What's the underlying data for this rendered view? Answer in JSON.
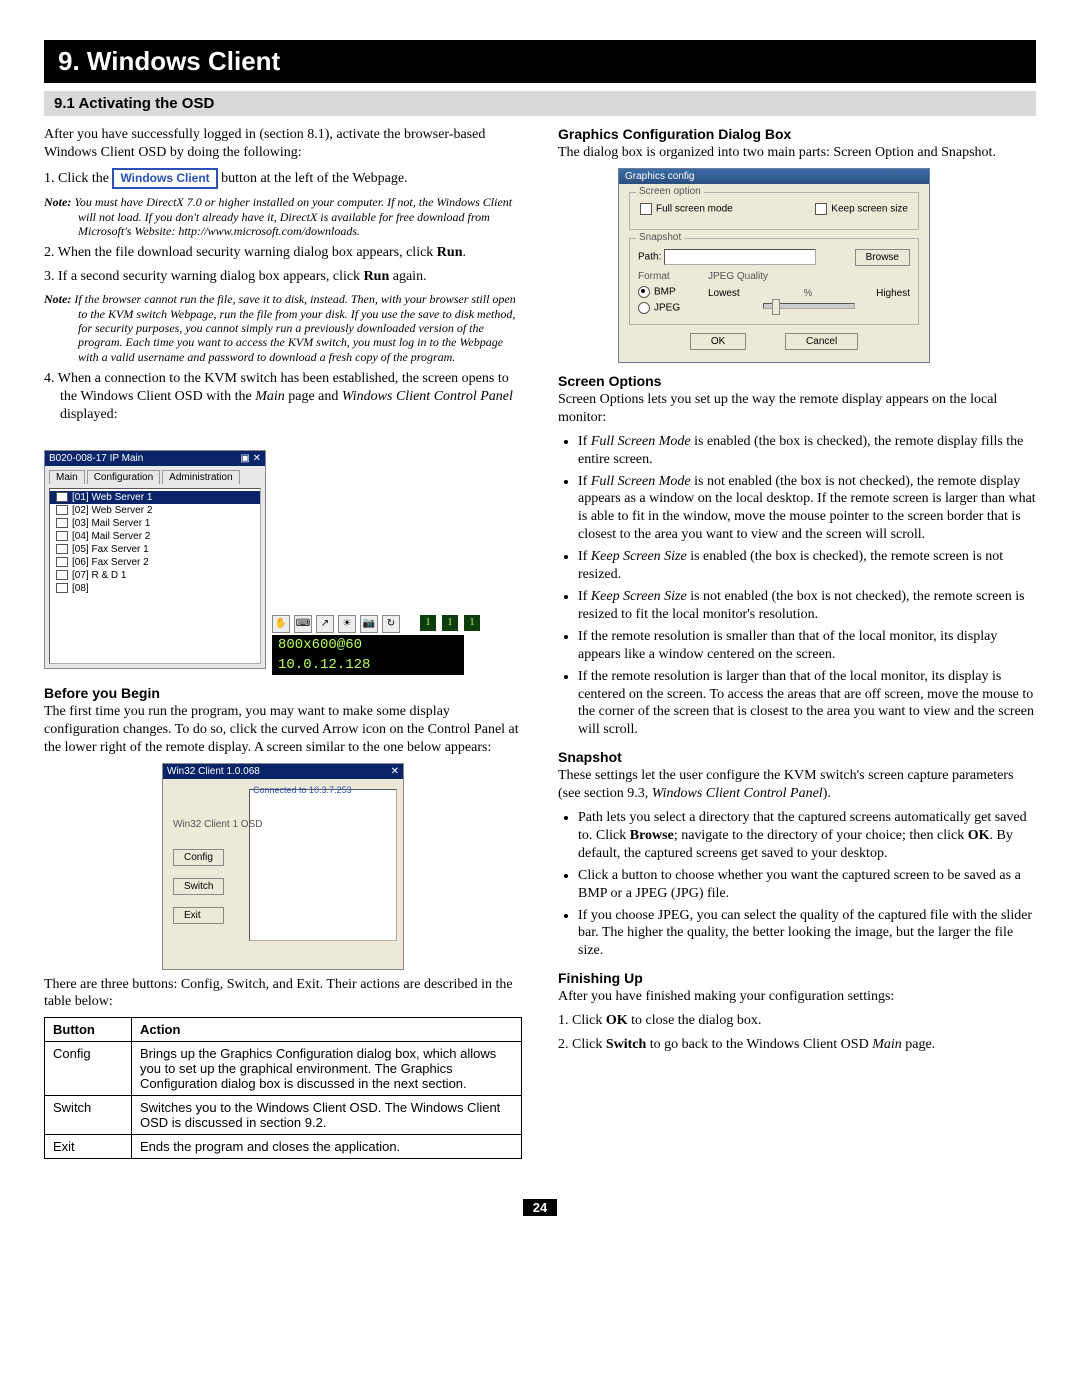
{
  "header": {
    "chapter": "9. Windows Client",
    "section": "9.1 Activating the OSD"
  },
  "left": {
    "intro": "After you have successfully logged in (section 8.1), activate the browser-based Windows Client OSD by doing the following:",
    "step1_pre": "1. Click the ",
    "wc_button": "Windows Client",
    "step1_post": " button at the left of the Webpage.",
    "note1_label": "Note:",
    "note1": "You must have DirectX 7.0 or higher installed on your computer. If not, the Windows Client will not load. If you don't already have it, DirectX is available for free download from Microsoft's Website: http://www.microsoft.com/downloads.",
    "step2_pre": "2. When the file download security warning dialog box appears, click ",
    "step2_bold": "Run",
    "step2_post": ".",
    "step3_pre": "3. If a second security warning dialog box appears, click ",
    "step3_bold": "Run",
    "step3_post": " again.",
    "note2_label": "Note:",
    "note2": "If the browser cannot run the file, save it to disk, instead. Then, with your browser still open to the KVM switch Webpage, run the file from your disk. If you use the save to disk method, for security purposes, you cannot simply run a previously downloaded version of the program. Each time you want to access the KVM switch, you must log in to the Webpage with a valid username and password to download a fresh copy of the program.",
    "step4_a": "4. When a connection to the KVM switch has been established, the screen opens to the Windows Client OSD with the ",
    "step4_i1": "Main",
    "step4_b": " page and ",
    "step4_i2": "Windows Client Control Panel",
    "step4_c": " displayed:",
    "osd": {
      "title": "B020-008-17 IP Main",
      "tabs": [
        "Main",
        "Configuration",
        "Administration"
      ],
      "items": [
        "[01] Web Server 1",
        "[02] Web Server 2",
        "[03] Mail Server 1",
        "[04] Mail Server 2",
        "[05] Fax Server 1",
        "[06] Fax Server 2",
        "[07] R & D 1",
        "[08]"
      ]
    },
    "ctrl": {
      "res": "800x600@60",
      "ip": "10.0.12.128",
      "nums": [
        "1",
        "1",
        "1"
      ]
    },
    "before_head": "Before you Begin",
    "before_text": "The first time you run the program, you may want to make some display configuration changes. To do so, click the curved Arrow icon on the Control Panel at the lower right of the remote display. A screen similar to the one below appears:",
    "cfg": {
      "title": "Win32 Client 1.0.068",
      "connected": "Connected to 10.3.7.253",
      "label": "Win32 Client 1 OSD",
      "buttons": [
        "Config",
        "Switch",
        "Exit"
      ]
    },
    "table_intro": "There are three buttons: Config, Switch, and Exit. Their actions are described in the table below:",
    "table": {
      "headers": [
        "Button",
        "Action"
      ],
      "rows": [
        {
          "b": "Config",
          "a": "Brings up the Graphics Configuration dialog box, which allows you to set up the graphical environment. The Graphics Configuration dialog box is discussed in the next section."
        },
        {
          "b": "Switch",
          "a": "Switches you to the Windows Client OSD. The Windows Client OSD is discussed in section 9.2."
        },
        {
          "b": "Exit",
          "a": "Ends the program and closes the application."
        }
      ]
    }
  },
  "right": {
    "gfx_head": "Graphics Configuration Dialog Box",
    "gfx_intro": "The dialog box is organized into two main parts: Screen Option and Snapshot.",
    "dialog": {
      "title": "Graphics config",
      "screen_legend": "Screen option",
      "full_screen": "Full screen mode",
      "keep_size": "Keep screen size",
      "snapshot_legend": "Snapshot",
      "path": "Path:",
      "browse": "Browse",
      "format": "Format",
      "quality": "JPEG Quality",
      "bmp": "BMP",
      "jpeg": "JPEG",
      "lowest": "Lowest",
      "highest": "Highest",
      "ok": "OK",
      "cancel": "Cancel"
    },
    "screen_head": "Screen Options",
    "screen_intro": "Screen Options lets you set up the way the remote display appears on the local monitor:",
    "screen_bullets": [
      {
        "pre": "If ",
        "em": "Full Screen Mode",
        "post": " is enabled (the box is checked), the remote display fills the entire screen."
      },
      {
        "pre": "If ",
        "em": "Full Screen Mode",
        "post": " is not enabled (the box is not checked), the remote display appears as a window on the local desktop. If the remote screen is larger than what is able to fit in the window, move the mouse pointer to the screen border that is closest to the area you want to view and the screen will scroll."
      },
      {
        "pre": "If ",
        "em": "Keep Screen Size",
        "post": " is enabled (the box is checked), the remote screen is not resized."
      },
      {
        "pre": "If ",
        "em": "Keep Screen Size",
        "post": " is not enabled (the box is not checked), the remote screen is resized to fit the local monitor's resolution."
      },
      {
        "plain": "If the remote resolution is smaller than that of the local monitor, its display appears like a window centered on the screen."
      },
      {
        "plain": "If the remote resolution is larger than that of the local monitor, its display is centered on the screen. To access the areas that are off screen, move the mouse to the corner of the screen that is closest to the area you want to view and the screen will scroll."
      }
    ],
    "snap_head": "Snapshot",
    "snap_intro_a": "These settings let the user configure the KVM switch's screen capture parameters (see section 9.3, ",
    "snap_intro_em": "Windows Client Control Panel",
    "snap_intro_b": ").",
    "snap_bullets": [
      {
        "text_a": "Path lets you select a directory that the captured screens automatically get saved to. Click ",
        "b1": "Browse",
        "text_b": "; navigate to the directory of your choice; then click ",
        "b2": "OK",
        "text_c": ". By default, the captured screens get saved to your desktop."
      },
      {
        "plain": "Click a button to choose whether you want the captured screen to be saved as a BMP or a JPEG (JPG) file."
      },
      {
        "plain": "If you choose JPEG, you can select the quality of the captured file with the slider bar. The higher the quality, the better looking the image, but the larger the file size."
      }
    ],
    "finish_head": "Finishing Up",
    "finish_intro": "After you have finished making your configuration settings:",
    "finish1_a": "1. Click ",
    "finish1_b": "OK",
    "finish1_c": " to close the dialog box.",
    "finish2_a": "2. Click ",
    "finish2_b": "Switch",
    "finish2_c": " to go back to the Windows Client OSD ",
    "finish2_em": "Main",
    "finish2_d": " page."
  },
  "page_number": "24"
}
